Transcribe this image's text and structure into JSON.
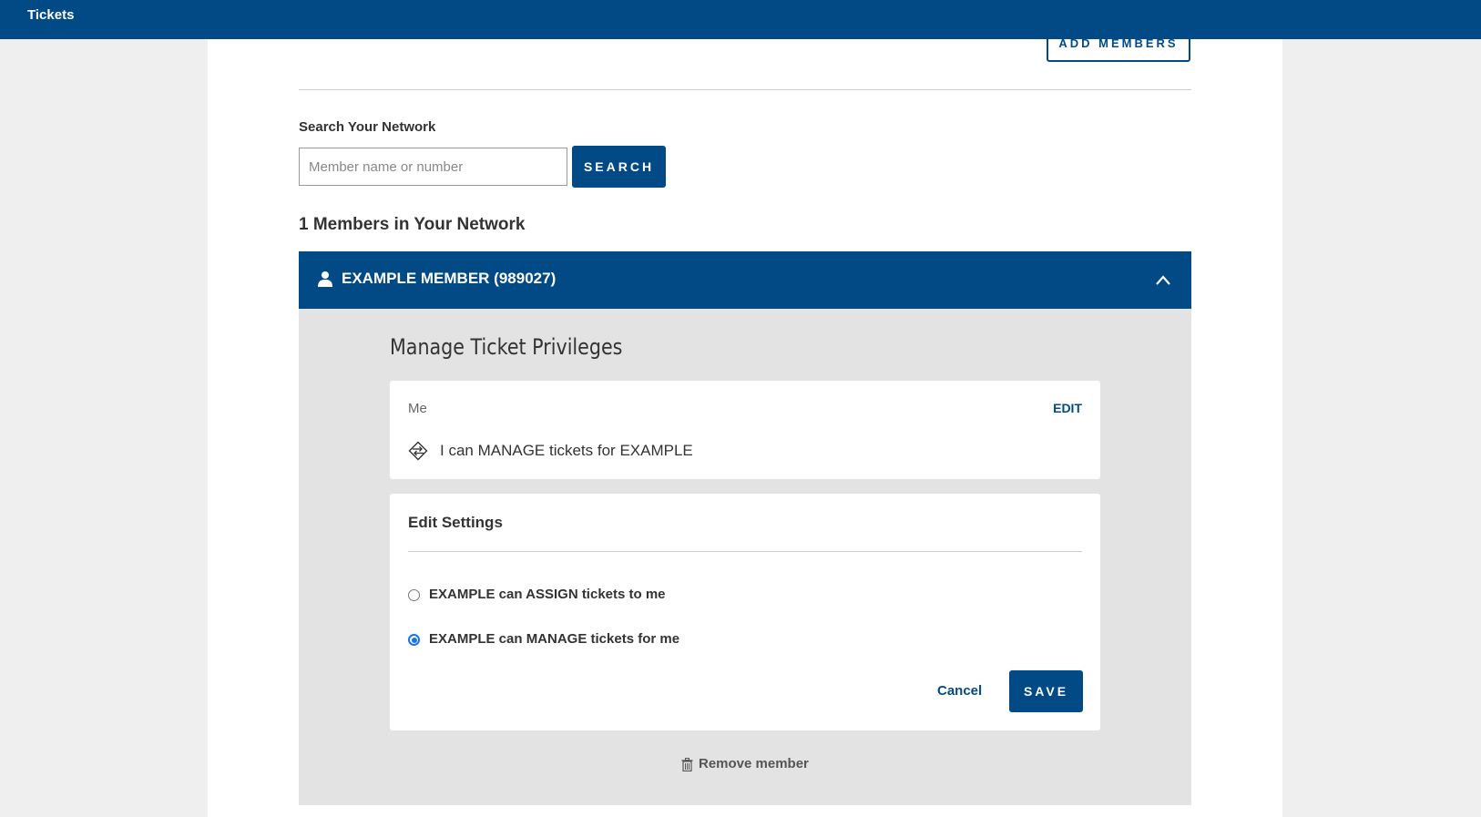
{
  "topbar": {
    "title": "Tickets"
  },
  "header_actions": {
    "add_members_label": "ADD MEMBERS"
  },
  "search": {
    "label": "Search Your Network",
    "placeholder": "Member name or number",
    "button_label": "SEARCH"
  },
  "network": {
    "count_label": "1 Members in Your Network",
    "member": {
      "name": "EXAMPLE MEMBER (989027)",
      "icon": "person-icon",
      "expanded": true
    }
  },
  "privileges": {
    "title": "Manage Ticket Privileges",
    "me_card": {
      "label": "Me",
      "edit_label": "EDIT",
      "status_text": "I can MANAGE tickets for EXAMPLE",
      "icon": "ticket-icon"
    },
    "edit_settings": {
      "title": "Edit Settings",
      "options": [
        {
          "label": "EXAMPLE can ASSIGN tickets to me",
          "selected": false
        },
        {
          "label": "EXAMPLE can MANAGE tickets for me",
          "selected": true
        }
      ],
      "cancel_label": "Cancel",
      "save_label": "SAVE"
    },
    "remove_label": "Remove member"
  },
  "colors": {
    "brand": "#024a86",
    "radio_selected": "#1a73e8",
    "panel_bg": "#e3e3e3"
  }
}
